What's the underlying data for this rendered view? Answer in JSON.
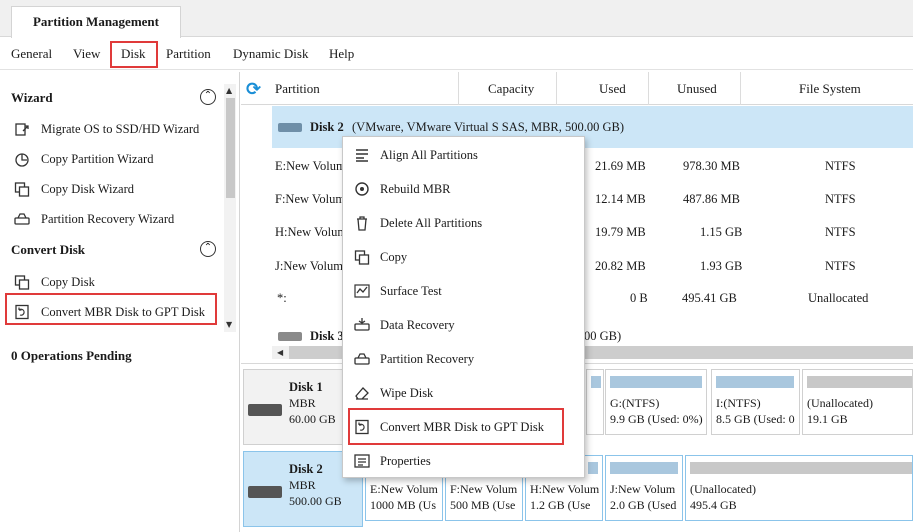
{
  "tabs": {
    "active": "Partition Management"
  },
  "menubar": {
    "items": [
      "General",
      "View",
      "Disk",
      "Partition",
      "Dynamic Disk",
      "Help"
    ]
  },
  "left_panel": {
    "wizard_title": "Wizard",
    "wizard_items": [
      "Migrate OS to SSD/HD Wizard",
      "Copy Partition Wizard",
      "Copy Disk Wizard",
      "Partition Recovery Wizard"
    ],
    "convert_title": "Convert Disk",
    "convert_items": [
      "Copy Disk",
      "Convert MBR Disk to GPT Disk"
    ],
    "pending": "0 Operations Pending"
  },
  "grid": {
    "headers": [
      "Partition",
      "Capacity",
      "Used",
      "Unused",
      "File System"
    ],
    "disk2_label": "Disk 2",
    "disk2_desc": "(VMware, VMware Virtual S SAS, MBR, 500.00 GB)",
    "rows": [
      {
        "partition": "E:New Volum",
        "used": "21.69 MB",
        "unused": "978.30 MB",
        "fs": "NTFS"
      },
      {
        "partition": "F:New Volum",
        "used": "12.14 MB",
        "unused": "487.86 MB",
        "fs": "NTFS"
      },
      {
        "partition": "H:New Volum",
        "used": "19.79 MB",
        "unused": "1.15 GB",
        "fs": "NTFS"
      },
      {
        "partition": "J:New Volum",
        "used": "20.82 MB",
        "unused": "1.93 GB",
        "fs": "NTFS"
      },
      {
        "partition": "*:",
        "used": "0 B",
        "unused": "495.41 GB",
        "fs": "Unallocated"
      }
    ],
    "disk3_label": "Disk 3",
    "disk3_tail": "00 GB)"
  },
  "context_menu": {
    "items": [
      {
        "label": "Align All Partitions",
        "icon": "align-icon"
      },
      {
        "label": "Rebuild MBR",
        "icon": "rebuild-icon"
      },
      {
        "label": "Delete All Partitions",
        "icon": "trash-icon"
      },
      {
        "label": "Copy",
        "icon": "copy-icon"
      },
      {
        "label": "Surface Test",
        "icon": "surface-test-icon"
      },
      {
        "label": "Data Recovery",
        "icon": "data-recovery-icon"
      },
      {
        "label": "Partition Recovery",
        "icon": "partition-recovery-icon"
      },
      {
        "label": "Wipe Disk",
        "icon": "eraser-icon"
      },
      {
        "label": "Convert MBR Disk to GPT Disk",
        "icon": "convert-icon"
      },
      {
        "label": "Properties",
        "icon": "properties-icon"
      }
    ]
  },
  "disk_map": {
    "disk1": {
      "name": "Disk 1",
      "type": "MBR",
      "size": "60.00 GB",
      "partitions": [
        {
          "l1": "G:(NTFS)",
          "l2": "9.9 GB (Used: 0%)"
        },
        {
          "l1": "I:(NTFS)",
          "l2": "8.5 GB (Used: 0"
        },
        {
          "l1": "(Unallocated)",
          "l2": "19.1 GB"
        }
      ]
    },
    "disk2": {
      "name": "Disk 2",
      "type": "MBR",
      "size": "500.00 GB",
      "partitions": [
        {
          "l1": "E:New Volum",
          "l2": "1000 MB (Us"
        },
        {
          "l1": "F:New Volum",
          "l2": "500 MB (Use"
        },
        {
          "l1": "H:New Volum",
          "l2": "1.2 GB (Use"
        },
        {
          "l1": "J:New Volum",
          "l2": "2.0 GB (Used"
        },
        {
          "l1": "(Unallocated)",
          "l2": "495.4 GB"
        }
      ]
    }
  },
  "colors": {
    "highlight": "#e03a3a",
    "selection": "#cce6f7",
    "accent": "#1a8ed6"
  }
}
